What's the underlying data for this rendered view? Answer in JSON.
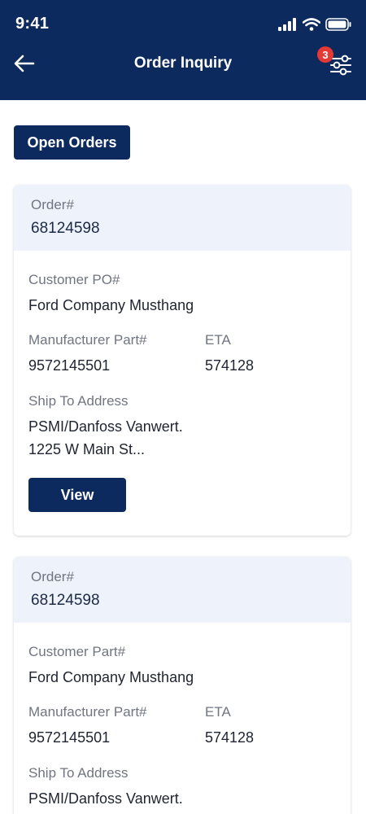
{
  "status_bar": {
    "time": "9:41"
  },
  "header": {
    "title": "Order Inquiry",
    "filter_badge": "3"
  },
  "filter_chip": {
    "label": "Open Orders"
  },
  "orders": [
    {
      "order_label": "Order#",
      "order_number": "68124598",
      "po_label": "Customer PO#",
      "po_value": "Ford Company Musthang",
      "part_label": "Manufacturer Part#",
      "part_value": "9572145501",
      "eta_label": "ETA",
      "eta_value": "574128",
      "address_label": "Ship To Address",
      "address_line1": "PSMI/Danfoss Vanwert.",
      "address_line2": "1225 W Main St...",
      "view_label": "View"
    },
    {
      "order_label": "Order#",
      "order_number": "68124598",
      "po_label": "Customer Part#",
      "po_value": "Ford Company Musthang",
      "part_label": "Manufacturer Part#",
      "part_value": "9572145501",
      "eta_label": "ETA",
      "eta_value": "574128",
      "address_label": "Ship To Address",
      "address_line1": "PSMI/Danfoss Vanwert."
    }
  ],
  "colors": {
    "brand": "#0d2a5e",
    "badge": "#e53935",
    "card_header": "#eef2fb"
  }
}
